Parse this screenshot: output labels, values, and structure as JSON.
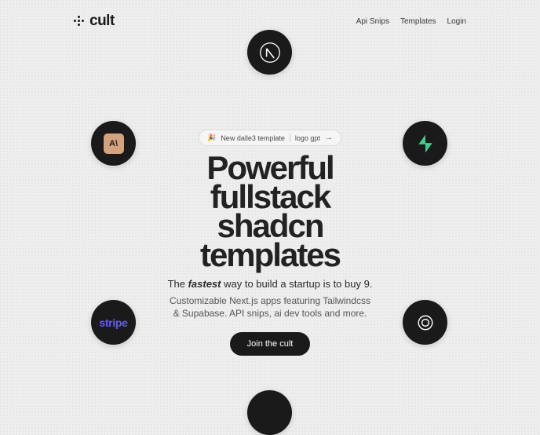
{
  "brand": {
    "name": "cult"
  },
  "nav": {
    "items": [
      {
        "label": "Api Snips"
      },
      {
        "label": "Templates"
      },
      {
        "label": "Login"
      }
    ]
  },
  "announcement": {
    "emoji": "🎉",
    "text_a": "New dalle3 template",
    "text_b": "logo gpt",
    "arrow": "→"
  },
  "hero": {
    "headline_l1": "Powerful",
    "headline_l2": "fullstack",
    "headline_l3": "shadcn",
    "headline_l4": "templates",
    "sub_pre": "The ",
    "sub_italic": "fastest",
    "sub_post": " way to build a startup is to buy 9.",
    "desc": "Customizable Next.js apps featuring Tailwindcss & Supabase. API snips, ai dev tools and more.",
    "cta": "Join the cult"
  },
  "orbs": {
    "nextjs": "nextjs-icon",
    "anthropic": "anthropic-icon",
    "anthropic_label": "A\\",
    "supabase": "supabase-icon",
    "stripe": "stripe-icon",
    "stripe_label": "stripe",
    "openai": "openai-icon"
  },
  "colors": {
    "bg": "#eeeeee",
    "text": "#1a1a1a",
    "supabase": "#3ecf8e",
    "stripe": "#635bff",
    "anthropic_bg": "#d4a27f"
  }
}
